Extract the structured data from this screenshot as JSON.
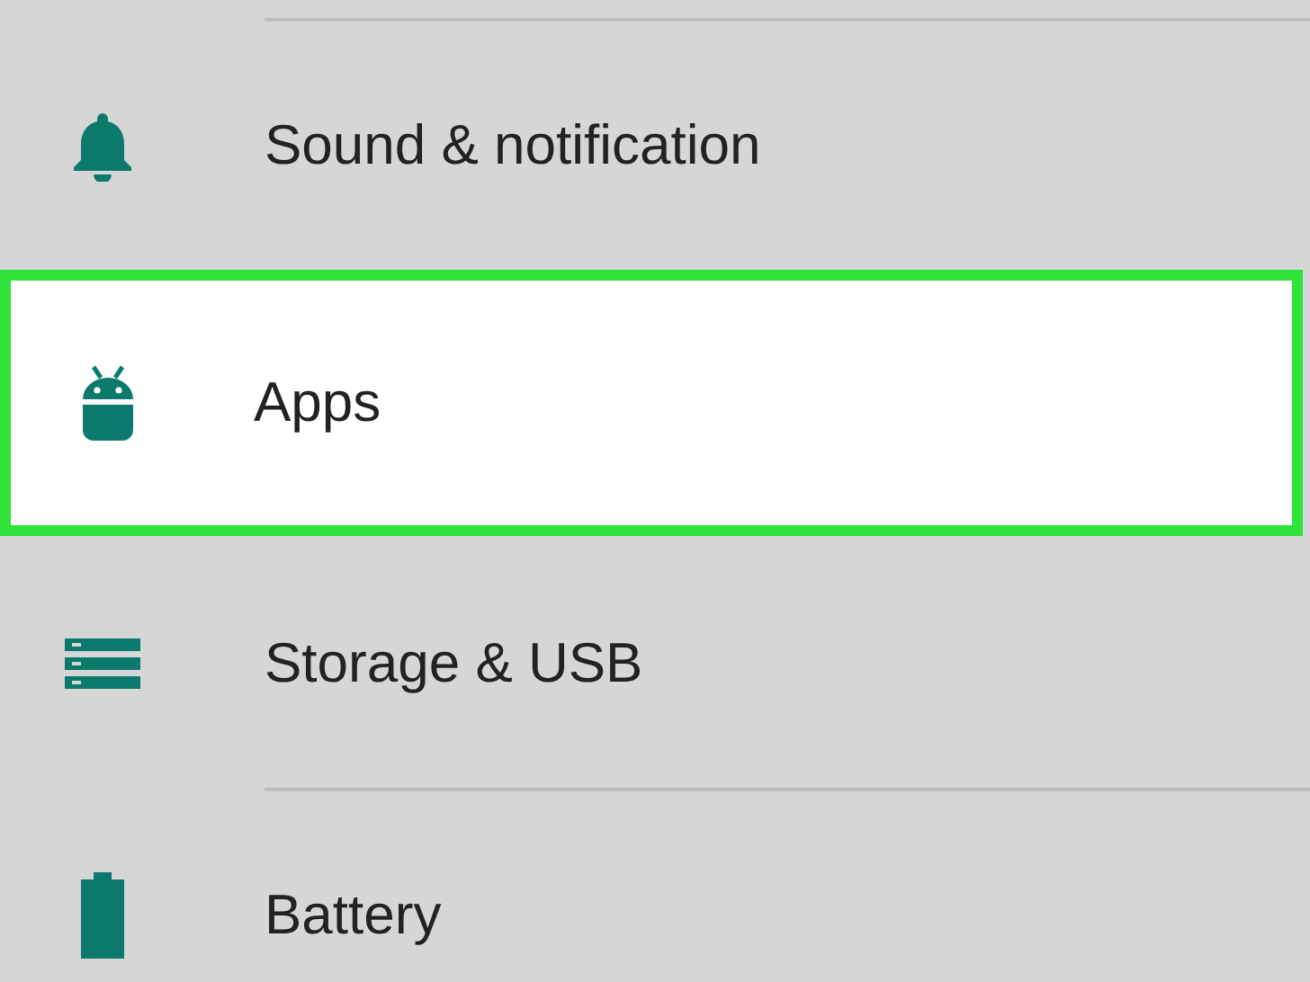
{
  "settings_items": [
    {
      "label": "Sound & notification",
      "kind": "bell",
      "selected": false
    },
    {
      "label": "Apps",
      "kind": "android",
      "selected": true
    },
    {
      "label": "Storage & USB",
      "kind": "storage",
      "selected": false
    },
    {
      "label": "Battery",
      "kind": "battery",
      "selected": false
    }
  ]
}
